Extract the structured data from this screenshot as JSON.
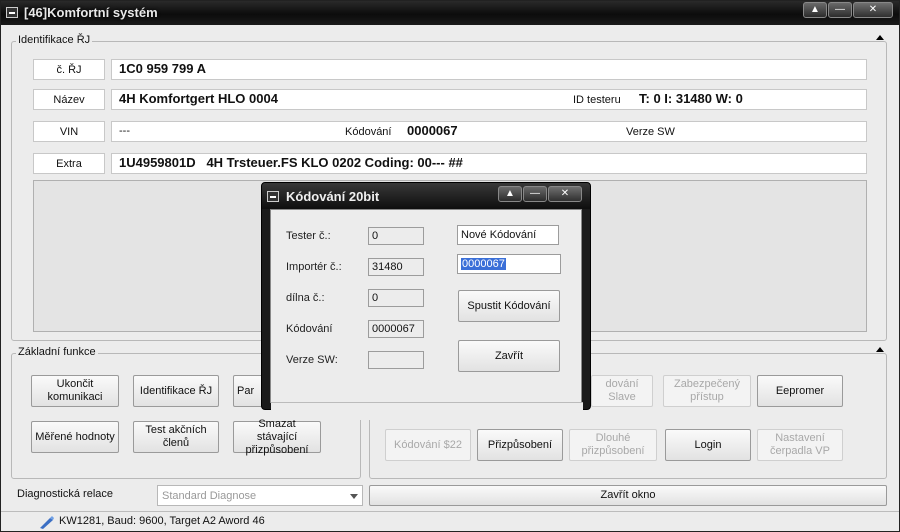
{
  "window": {
    "title": "[46]Komfortní systém",
    "controls": {
      "restore": "▲",
      "minimize": "—",
      "close": "✕"
    }
  },
  "identification": {
    "group_label": "Identifikace ŘJ",
    "rows": {
      "part_no": {
        "label": "č. ŘJ",
        "value": "1C0 959 799 A"
      },
      "name": {
        "label": "Název",
        "value": "4H Komfortgert HLO 0004",
        "tester_label": "ID testeru",
        "tester_value": "T: 0 I: 31480 W: 0"
      },
      "vin": {
        "label": "VIN",
        "value": "---",
        "coding_label": "Kódování",
        "coding_value": "0000067",
        "sw_label": "Verze SW",
        "sw_value": ""
      },
      "extra": {
        "label": "Extra",
        "value": "1U4959801D   4H Trsteuer.FS KLO 0202 Coding: 00--- ##"
      }
    }
  },
  "basic_functions": {
    "group_label": "Základní funkce",
    "buttons": {
      "end_comm": "Ukončit komunikaci",
      "ident": "Identifikace ŘJ",
      "par": "Par",
      "measured": "Měřené hodnoty",
      "test": "Test akčních členů",
      "erase": "Smazat stávající přizpůsobení"
    }
  },
  "advanced": {
    "buttons": {
      "coding_slave": "dování Slave",
      "security": "Zabezpečený přístup",
      "eepromer": "Eepromer",
      "coding_22": "Kódování $22",
      "adaptation": "Přizpůsobení",
      "long_adapt": "Dlouhé přizpůsobení",
      "login": "Login",
      "pump": "Nastavení čerpadla VP"
    }
  },
  "diagnostics": {
    "label": "Diagnostická relace",
    "selected": "Standard Diagnose",
    "close_window": "Zavřít okno"
  },
  "status": {
    "text": "KW1281, Baud: 9600, Target A2 Aword 46"
  },
  "dialog": {
    "title": "Kódování 20bit",
    "tester_label": "Tester č.:",
    "tester_value": "0",
    "importer_label": "Importér č.:",
    "importer_value": "31480",
    "workshop_label": "dílna č.:",
    "workshop_value": "0",
    "coding_label": "Kódování",
    "coding_value": "0000067",
    "sw_label": "Verze SW:",
    "sw_value": "",
    "new_coding_label": "Nové Kódování",
    "new_coding_value": "0000067",
    "start_button": "Spustit Kódování",
    "close_button": "Zavřít"
  }
}
